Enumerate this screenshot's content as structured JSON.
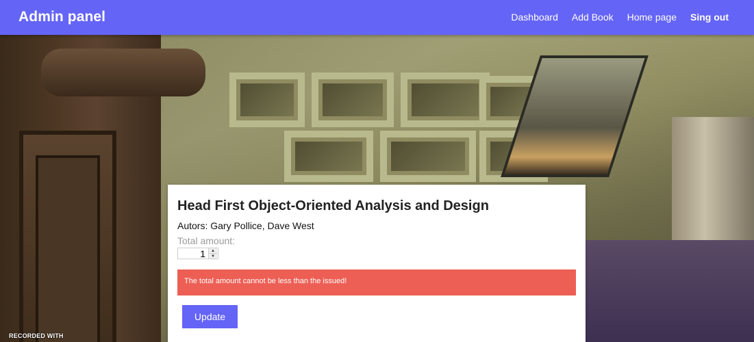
{
  "navbar": {
    "brand": "Admin panel",
    "links": [
      {
        "label": "Dashboard"
      },
      {
        "label": "Add Book"
      },
      {
        "label": "Home page"
      },
      {
        "label": "Sing out"
      }
    ]
  },
  "card": {
    "title": "Head First Object-Oriented Analysis and Design",
    "authors": "Autors: Gary Pollice, Dave West",
    "amount_label": "Total amount:",
    "amount_value": "1",
    "error": "The total amount cannot be less than the issued!",
    "update_label": "Update"
  },
  "watermark": "RECORDED WITH",
  "colors": {
    "primary": "#6464f6",
    "error": "#ed5f55",
    "card_bg": "#ffffff"
  },
  "icons": {
    "spin_up": "triangle-up-icon",
    "spin_down": "triangle-down-icon"
  }
}
